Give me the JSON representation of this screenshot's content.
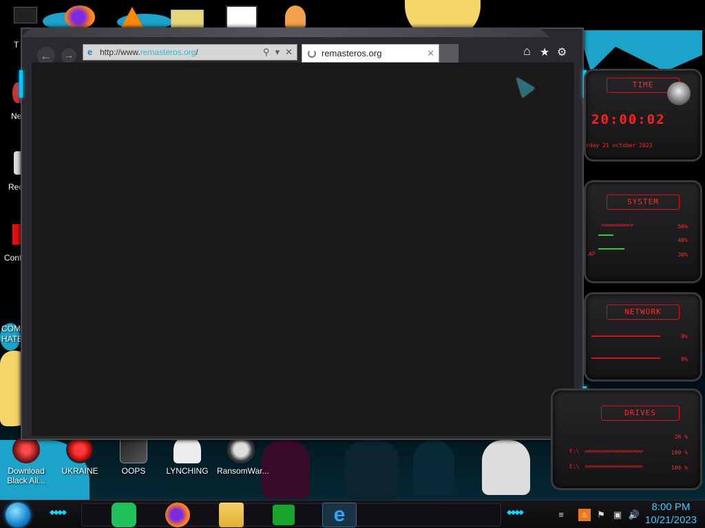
{
  "desktop": {
    "icons_bottom": [
      {
        "name": "download-black-alienware-icon",
        "label": "Download Black Ali..."
      },
      {
        "name": "ukraine-icon",
        "label": "UKRAINE"
      },
      {
        "name": "oops-icon",
        "label": "OOPS"
      },
      {
        "name": "lynching-icon",
        "label": "LYNCHING"
      },
      {
        "name": "ransomware-icon",
        "label": "RansomWar..."
      }
    ],
    "edge_labels": [
      "T",
      "Ne",
      "Rec",
      "Cont",
      "COMM",
      "HATE"
    ]
  },
  "browser": {
    "url_prefix": "http://www.",
    "url_domain": "remasteros.org",
    "url_suffix": "/",
    "tab_title": "remasteros.org",
    "tab_close": "✕",
    "addr_search": "⚲",
    "addr_dropdown": "▾",
    "addr_close": "✕",
    "back": "←",
    "forward": "→",
    "home": "⌂",
    "favorites": "★",
    "settings": "⚙"
  },
  "gadgets": {
    "time": {
      "title": "TIME",
      "time": "20:00:02",
      "date": "rday 21 october 2023"
    },
    "system": {
      "title": "SYSTEM",
      "cpu_pct": "56%",
      "mem_pct": "46%",
      "swap_label": "AP",
      "swap_pct": "30%"
    },
    "network": {
      "title": "NETWORK",
      "up_pct": "0%",
      "down_pct": "0%"
    },
    "drives": {
      "title": "DRIVES",
      "c_pct": "26 %",
      "f_label": "F:\\",
      "f_pct": "100 %",
      "e_label": "E:\\",
      "e_pct": "100 %"
    }
  },
  "taskbar": {
    "time": "8:00 PM",
    "date": "10/21/2023"
  },
  "colors": {
    "accent_cyan": "#00c8ff",
    "gadget_red": "#ff2020",
    "clock_blue": "#3ec8ff"
  }
}
